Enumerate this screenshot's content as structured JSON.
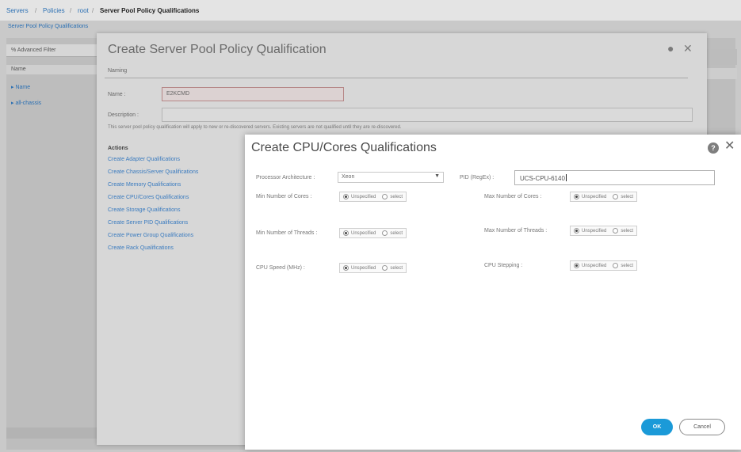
{
  "breadcrumb": {
    "items": [
      "Servers",
      "Policies",
      "root"
    ],
    "current": "Server Pool Policy Qualifications",
    "separator": "/"
  },
  "background": {
    "subtitle": "Server Pool Policy Qualifications",
    "toolbar_label": "% Advanced Filter",
    "column_header": "Name",
    "rows": [
      "▸ Name",
      "▸ all-chassis"
    ]
  },
  "modal1": {
    "title": "Create Server Pool Policy Qualification",
    "tab": "Naming",
    "name_label": "Name :",
    "name_value": "E2KCMD",
    "description_label": "Description :",
    "note": "This server pool policy qualification will apply to new or re-discovered servers. Existing servers are not qualified until they are re-discovered.",
    "actions_title": "Actions",
    "actions": [
      "Create Adapter Qualifications",
      "Create Chassis/Server Qualifications",
      "Create Memory Qualifications",
      "Create CPU/Cores Qualifications",
      "Create Storage Qualifications",
      "Create Server PID Qualifications",
      "Create Power Group Qualifications",
      "Create Rack Qualifications"
    ]
  },
  "modal2": {
    "title": "Create CPU/Cores Qualifications",
    "processor_arch_label": "Processor Architecture :",
    "processor_arch_value": "Xeon",
    "pid_label": "PID (RegEx) :",
    "pid_value": "UCS-CPU-6140",
    "unspecified_label": "Unspecified",
    "select_label": "select",
    "fields": {
      "min_cores": "Min Number of Cores :",
      "max_cores": "Max Number of Cores :",
      "min_threads": "Min Number of Threads :",
      "max_threads": "Max Number of Threads :",
      "cpu_speed": "CPU Speed (MHz) :",
      "cpu_stepping": "CPU Stepping :"
    },
    "ok_label": "OK",
    "cancel_label": "Cancel"
  },
  "colors": {
    "accent": "#1b9ad8",
    "link": "#3a7bbf",
    "invalid_border": "#b58686"
  }
}
